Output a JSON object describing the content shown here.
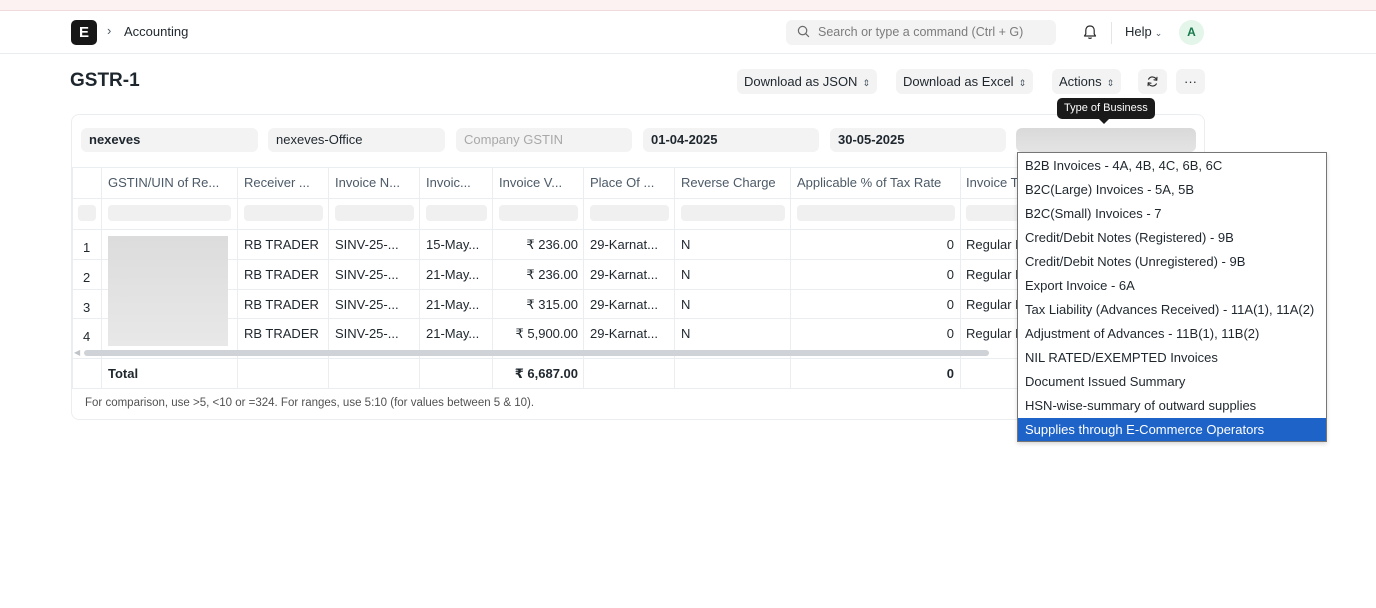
{
  "navbar": {
    "logo": "E",
    "breadcrumb": "Accounting",
    "search_placeholder": "Search or type a command (Ctrl + G)",
    "help_label": "Help",
    "avatar_initial": "A"
  },
  "page": {
    "title": "GSTR-1",
    "actions": {
      "download_json": "Download as JSON",
      "download_excel": "Download as Excel",
      "actions": "Actions",
      "more": "···"
    }
  },
  "filters": {
    "company": "nexeves",
    "company_address": "nexeves-Office",
    "company_gstin_placeholder": "Company GSTIN",
    "from_date": "01-04-2025",
    "to_date": "30-05-2025",
    "type_of_business_tooltip": "Type of Business"
  },
  "table": {
    "columns": [
      "GSTIN/UIN of Re...",
      "Receiver ...",
      "Invoice N...",
      "Invoic...",
      "Invoice V...",
      "Place Of ...",
      "Reverse Charge",
      "Applicable % of Tax Rate",
      "Invoice T"
    ],
    "rows": [
      {
        "index": "1",
        "receiver": "RB TRADER",
        "invoice_no": "SINV-25-...",
        "date": "15-May...",
        "value": "₹ 236.00",
        "place": "29-Karnat...",
        "reverse_charge": "N",
        "tax_rate": "0",
        "invoice_type": "Regular B"
      },
      {
        "index": "2",
        "receiver": "RB TRADER",
        "invoice_no": "SINV-25-...",
        "date": "21-May...",
        "value": "₹ 236.00",
        "place": "29-Karnat...",
        "reverse_charge": "N",
        "tax_rate": "0",
        "invoice_type": "Regular B"
      },
      {
        "index": "3",
        "receiver": "RB TRADER",
        "invoice_no": "SINV-25-...",
        "date": "21-May...",
        "value": "₹ 315.00",
        "place": "29-Karnat...",
        "reverse_charge": "N",
        "tax_rate": "0",
        "invoice_type": "Regular B"
      },
      {
        "index": "4",
        "receiver": "RB TRADER",
        "invoice_no": "SINV-25-...",
        "date": "21-May...",
        "value": "₹ 5,900.00",
        "place": "29-Karnat...",
        "reverse_charge": "N",
        "tax_rate": "0",
        "invoice_type": "Regular B"
      }
    ],
    "total_label": "Total",
    "total_value": "₹ 6,687.00",
    "total_tax_rate": "0",
    "note": "For comparison, use >5, <10 or =324. For ranges, use 5:10 (for values between 5 & 10)."
  },
  "dropdown": {
    "options": [
      "B2B Invoices - 4A, 4B, 4C, 6B, 6C",
      "B2C(Large) Invoices - 5A, 5B",
      "B2C(Small) Invoices - 7",
      "Credit/Debit Notes (Registered) - 9B",
      "Credit/Debit Notes (Unregistered) - 9B",
      "Export Invoice - 6A",
      "Tax Liability (Advances Received) - 11A(1), 11A(2)",
      "Adjustment of Advances - 11B(1), 11B(2)",
      "NIL RATED/EXEMPTED Invoices",
      "Document Issued Summary",
      "HSN-wise-summary of outward supplies",
      "Supplies through E-Commerce Operators"
    ],
    "selected": "Supplies through E-Commerce Operators"
  }
}
